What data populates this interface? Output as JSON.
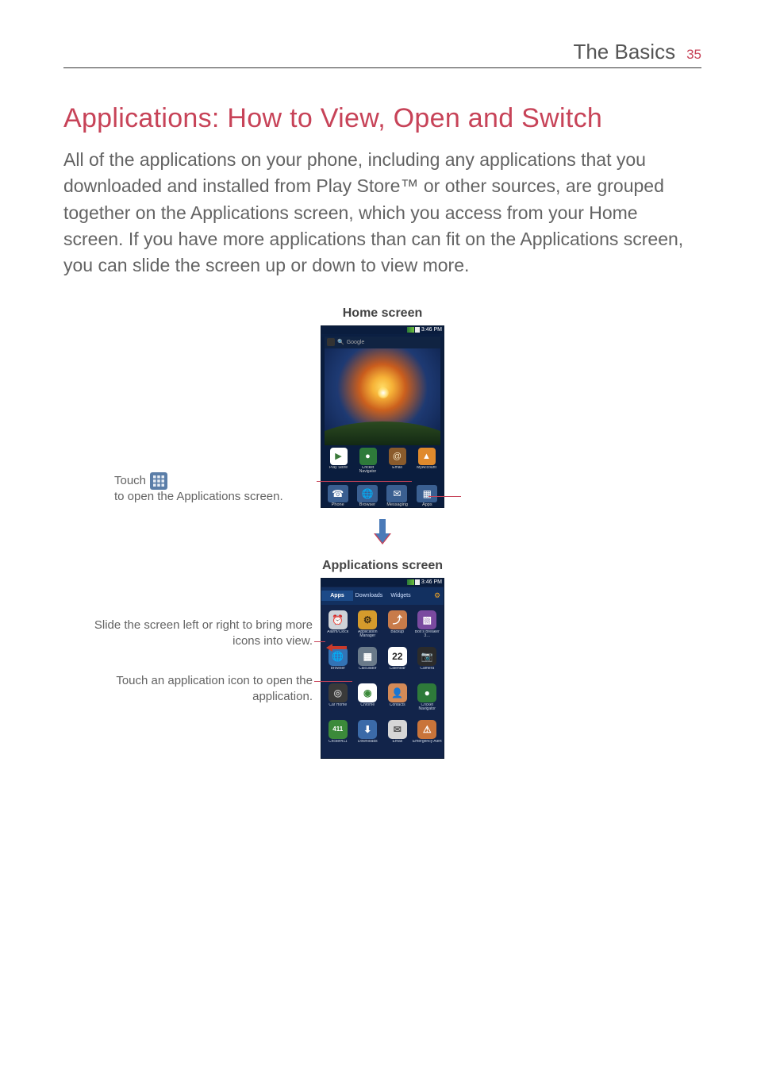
{
  "header": {
    "section": "The Basics",
    "page_number": "35"
  },
  "heading": "Applications: How to View, Open and Switch",
  "paragraph": "All of the applications on your phone, including any applications that you downloaded and installed from Play Store™ or other sources, are grouped together on the Applications screen, which you access from your Home screen. If you have more applications than can fit on the Applications screen, you can slide the screen up or down to view more.",
  "fig_home_label": "Home screen",
  "fig_apps_label": "Applications screen",
  "callout_touch_pre": "Touch ",
  "callout_touch_post": " to open the Applications screen.",
  "callout_slide": "Slide the screen left or right to bring more icons into view.",
  "callout_open": "Touch an application icon to open the application.",
  "status_time": "3:46 PM",
  "search_placeholder": "Google",
  "home_row": [
    {
      "label": "Play Store",
      "bg": "#ffffff",
      "glyph": "▶",
      "gcolor": "#3b7a3a"
    },
    {
      "label": "Cricket Navigator",
      "bg": "#2e7a3a",
      "glyph": "●",
      "gcolor": "#ffffff"
    },
    {
      "label": "Email",
      "bg": "#8a5b2c",
      "glyph": "@",
      "gcolor": "#f7e8c8"
    },
    {
      "label": "MyAccount",
      "bg": "#e08a2c",
      "glyph": "▲",
      "gcolor": "#ffffff"
    }
  ],
  "dock": [
    {
      "label": "Phone",
      "glyph": "☎",
      "bg": "#3a5f91"
    },
    {
      "label": "Browser",
      "glyph": "🌐",
      "bg": "#3a5f91"
    },
    {
      "label": "Messaging",
      "glyph": "✉",
      "bg": "#3a5f91"
    },
    {
      "label": "Apps",
      "glyph": "▦",
      "bg": "#3a5f91"
    }
  ],
  "apps_tabs": {
    "t1": "Apps",
    "t2": "Downloads",
    "t3": "Widgets"
  },
  "apps_grid": [
    {
      "label": "Alarm/Clock",
      "bg": "#cfd3d8",
      "glyph": "⏰",
      "gc": "#444"
    },
    {
      "label": "Application Manager",
      "bg": "#d59b2c",
      "glyph": "⚙",
      "gc": "#3b2b12"
    },
    {
      "label": "Backup",
      "bg": "#c87b4a",
      "glyph": "⤴",
      "gc": "#fff"
    },
    {
      "label": "Box's Breaker 3…",
      "bg": "#7a4aa0",
      "glyph": "▧",
      "gc": "#fff"
    },
    {
      "label": "Browser",
      "bg": "#3373b5",
      "glyph": "🌐",
      "gc": "#fff"
    },
    {
      "label": "Calculator",
      "bg": "#6a7a8a",
      "glyph": "▦",
      "gc": "#fff"
    },
    {
      "label": "Calendar",
      "bg": "#ffffff",
      "glyph": "22",
      "gc": "#222"
    },
    {
      "label": "Camera",
      "bg": "#2b2b2b",
      "glyph": "📷",
      "gc": "#e88a2c"
    },
    {
      "label": "Car Home",
      "bg": "#3a3a3a",
      "glyph": "◎",
      "gc": "#bbb"
    },
    {
      "label": "Chrome",
      "bg": "#ffffff",
      "glyph": "◉",
      "gc": "#3b8a3a"
    },
    {
      "label": "Contacts",
      "bg": "#d48a57",
      "glyph": "👤",
      "gc": "#fff"
    },
    {
      "label": "Cricket Navigator",
      "bg": "#2e7a3a",
      "glyph": "●",
      "gc": "#fff"
    },
    {
      "label": "Cricket411",
      "bg": "#3b8a3a",
      "glyph": "411",
      "gc": "#fff"
    },
    {
      "label": "Downloads",
      "bg": "#3b6aa8",
      "glyph": "⬇",
      "gc": "#fff"
    },
    {
      "label": "Email",
      "bg": "#d6d6d6",
      "glyph": "✉",
      "gc": "#555"
    },
    {
      "label": "Emergency Alert",
      "bg": "#c9743a",
      "glyph": "⚠",
      "gc": "#fff"
    }
  ]
}
